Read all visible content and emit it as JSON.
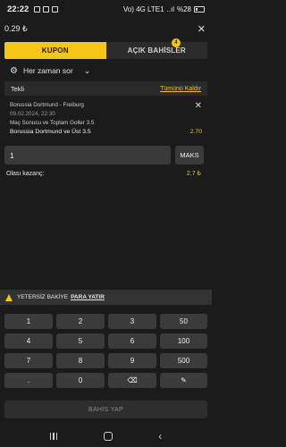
{
  "status": {
    "time": "22:22",
    "network": "Vo) 4G LTE1",
    "signal": "..ıl",
    "battery": "%28"
  },
  "header": {
    "balance": "0.29 ₺",
    "close": "✕"
  },
  "tabs": [
    {
      "label": "KUPON"
    },
    {
      "label": "AÇIK BAHİSLER",
      "badge": "4"
    }
  ],
  "odds_setting": {
    "label": "Her zaman sor",
    "icon": "gear-icon"
  },
  "bet_type": {
    "label": "Tekli",
    "remove_all": "Tümünü Kaldır"
  },
  "bet": {
    "match": "Borussia Dortmund - Freiburg",
    "date": "09.02.2024, 22:30",
    "market": "Maç Sonucu ve Toplam Goller 3.5",
    "selection": "Borussia Dortmund ve Üst 3.5",
    "odd": "2.70"
  },
  "stake": {
    "value": "1",
    "max_label": "MAKS"
  },
  "possible_win": {
    "label": "Olası kazanç:",
    "value": "2.7 ₺"
  },
  "warning": {
    "text": "YETERSİZ BAKİYE",
    "deposit": "PARA YATIR"
  },
  "keypad": {
    "digits": [
      "1",
      "2",
      "3",
      "4",
      "5",
      "6",
      "7",
      "8",
      "9",
      ".",
      "0"
    ],
    "quick": [
      "50",
      "100",
      "500"
    ],
    "backspace": "⌫",
    "edit": "✎"
  },
  "place_bet": {
    "label": "BAHİS YAP"
  },
  "colors": {
    "accent": "#f5c518",
    "background": "#1b1b1b",
    "key": "#3b3b3b"
  }
}
